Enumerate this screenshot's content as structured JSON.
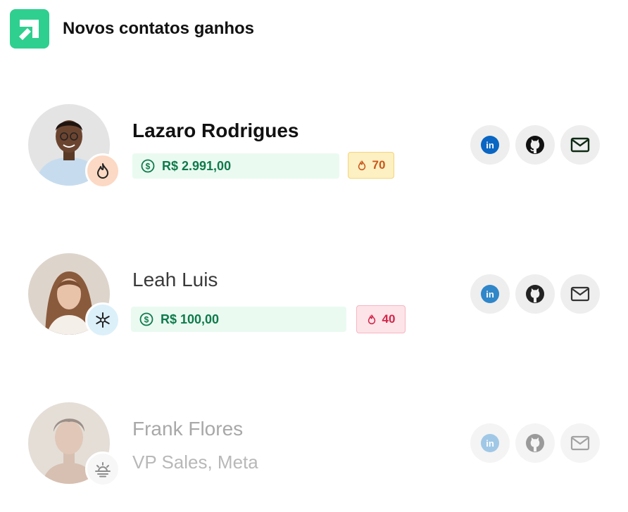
{
  "header": {
    "title": "Novos contatos ganhos",
    "logo_icon": "arrow-corner-icon"
  },
  "contacts": [
    {
      "name": "Lazaro Rodrigues",
      "value": "R$ 2.991,00",
      "score": "70",
      "status_icon": "flame-icon",
      "status_color": "#fcd9c4",
      "score_bg": "#fdf0c2",
      "score_color": "#c9571c"
    },
    {
      "name": "Leah Luis",
      "value": "R$ 100,00",
      "score": "40",
      "status_icon": "snowflake-icon",
      "status_color": "#dcf0fa",
      "score_bg": "#fde4e8",
      "score_color": "#d1264a"
    },
    {
      "name": "Frank Flores",
      "subtitle": "VP Sales, Meta",
      "status_icon": "sunrise-icon",
      "status_color": "#f1f1f1"
    }
  ],
  "social_icons": [
    "linkedin-icon",
    "github-icon",
    "mail-icon"
  ],
  "colors": {
    "brand": "#2fcf8f",
    "money_text": "#0f7a4a",
    "linkedin": "#0a66c2"
  }
}
